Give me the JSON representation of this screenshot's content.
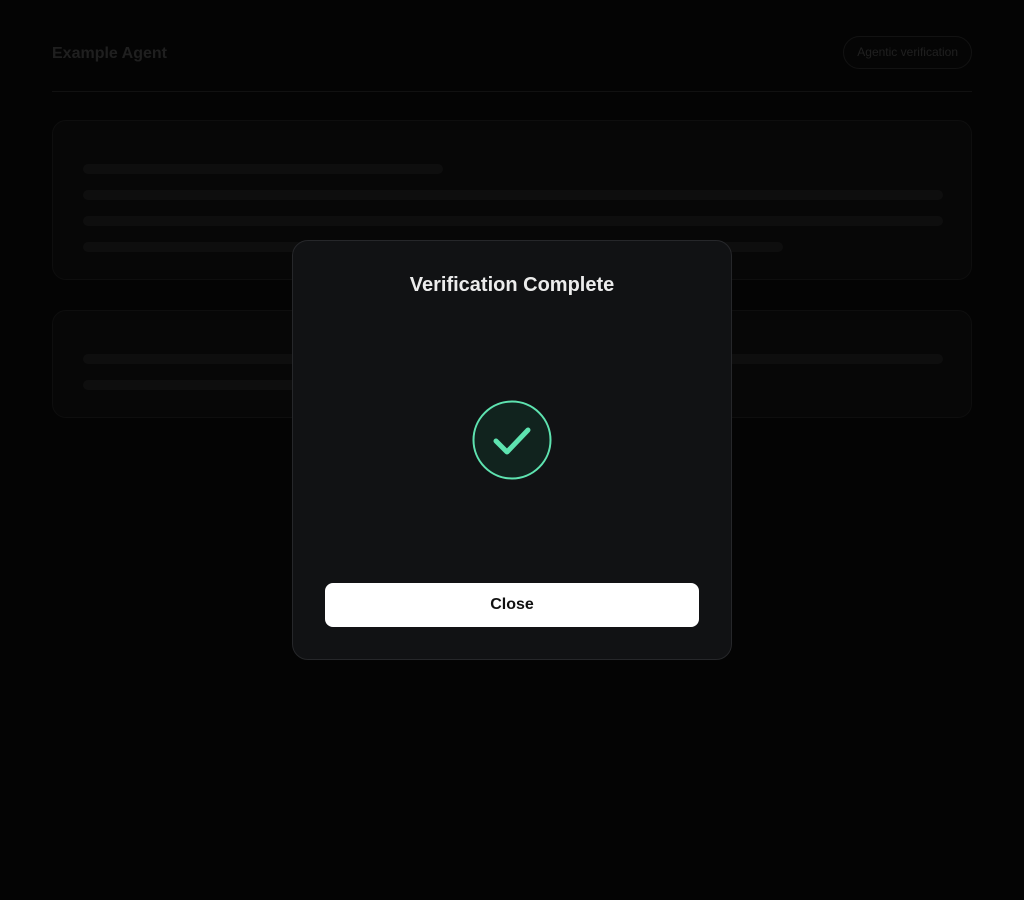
{
  "header": {
    "app_title": "Example Agent",
    "badge_label": "Agentic verification"
  },
  "modal": {
    "title": "Verification Complete",
    "status_icon": "check-circle-icon",
    "close_label": "Close"
  },
  "colors": {
    "background": "#000000",
    "modal_background": "#111214",
    "success_accent": "#5ee3b0",
    "success_fill": "#11231e",
    "button_background": "#ffffff",
    "button_text": "#111111"
  }
}
